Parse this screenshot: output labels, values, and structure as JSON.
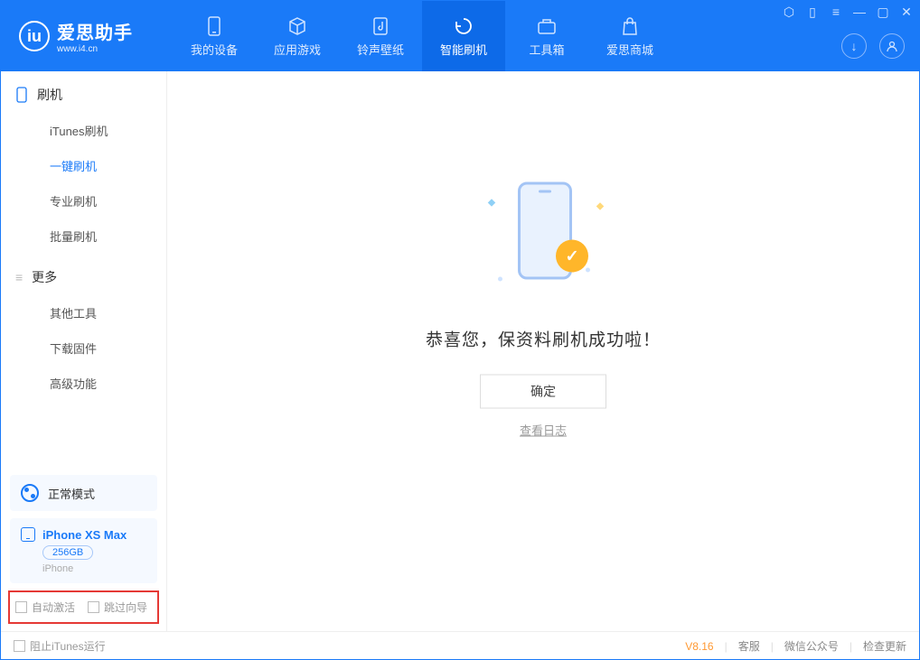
{
  "app": {
    "name": "爱思助手",
    "site": "www.i4.cn"
  },
  "tabs": {
    "device": "我的设备",
    "apps": "应用游戏",
    "ring": "铃声壁纸",
    "flash": "智能刷机",
    "tools": "工具箱",
    "store": "爱思商城"
  },
  "sidebar": {
    "flash_section": "刷机",
    "items_flash": {
      "itunes": "iTunes刷机",
      "onekey": "一键刷机",
      "pro": "专业刷机",
      "batch": "批量刷机"
    },
    "more_section": "更多",
    "items_more": {
      "other": "其他工具",
      "firmware": "下载固件",
      "advanced": "高级功能"
    }
  },
  "mode": {
    "label": "正常模式"
  },
  "device": {
    "name": "iPhone XS Max",
    "storage": "256GB",
    "type": "iPhone"
  },
  "options": {
    "auto_activate": "自动激活",
    "skip_guide": "跳过向导"
  },
  "main": {
    "success": "恭喜您，保资料刷机成功啦！",
    "ok": "确定",
    "view_log": "查看日志"
  },
  "footer": {
    "block_itunes": "阻止iTunes运行",
    "version": "V8.16",
    "support": "客服",
    "wechat": "微信公众号",
    "update": "检查更新"
  }
}
